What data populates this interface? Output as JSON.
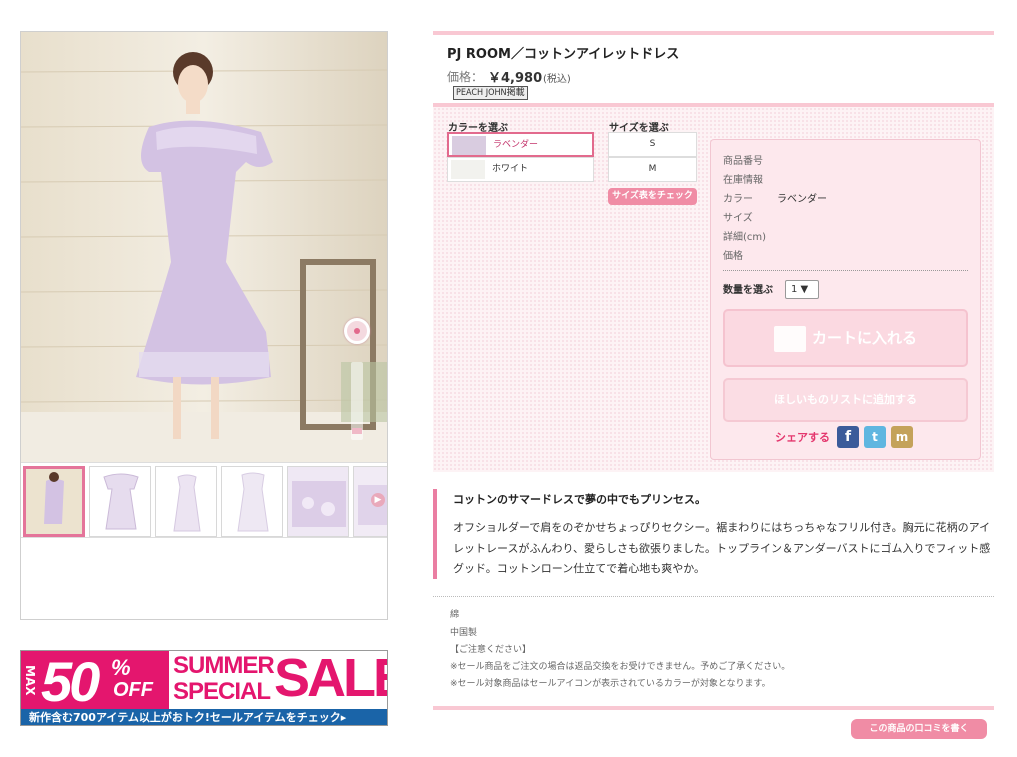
{
  "product": {
    "title": "PJ ROOM／コットンアイレットドレス",
    "price_label": "価格：",
    "price": "￥4,980",
    "tax": "(税込)",
    "tag": "PEACH JOHN掲載"
  },
  "options": {
    "color_label": "カラーを選ぶ",
    "size_label": "サイズを選ぶ",
    "colors": [
      {
        "label": "ラベンダー",
        "swatch": "#d9cce0",
        "selected": true
      },
      {
        "label": "ホワイト",
        "swatch": "#f2f2ee",
        "selected": false
      }
    ],
    "sizes": [
      "S",
      "M"
    ],
    "size_chart_button": "サイズ表をチェック"
  },
  "info": {
    "rows": [
      {
        "label": "商品番号",
        "value": ""
      },
      {
        "label": "在庫情報",
        "value": ""
      },
      {
        "label": "カラー",
        "value": "ラベンダー"
      },
      {
        "label": "サイズ",
        "value": ""
      },
      {
        "label": "詳細(cm)",
        "value": ""
      },
      {
        "label": "価格",
        "value": ""
      }
    ],
    "qty_label": "数量を選ぶ",
    "qty_value": "1 ▼",
    "cart_button": "カートに入れる",
    "wishlist_button": "ほしいものリストに追加する",
    "share_label": "シェアする"
  },
  "description": {
    "headline": "コットンのサマードレスで夢の中でもプリンセス。",
    "body": "オフショルダーで肩をのぞかせちょっぴりセクシー。裾まわりにはちっちゃなフリル付き。胸元に花柄のアイレットレースがふんわり、愛らしさも欲張りました。トップライン＆アンダーバストにゴム入りでフィット感グッド。コットンローン仕立てで着心地も爽やか。"
  },
  "material": {
    "lines": [
      "綿",
      "中国製",
      "【ご注意ください】",
      "※セール商品をご注文の場合は返品交換をお受けできません。予めご了承ください。",
      "※セール対象商品はセールアイコンが表示されているカラーが対象となります。"
    ]
  },
  "review_button": "この商品の口コミを書く",
  "banner": {
    "max": "MAX",
    "percent": "50",
    "percent_sign": "%",
    "off": "OFF",
    "summer": "SUMMER",
    "special": "SPECIAL",
    "sale": "SALE!",
    "sub": "新作含む700アイテム以上がおトク!セールアイテムをチェック▸"
  },
  "colors": {
    "accent": "#e4376e",
    "pink_light": "#f9c8d3",
    "banner_pink": "#e4166e",
    "banner_blue": "#1a64a8"
  }
}
